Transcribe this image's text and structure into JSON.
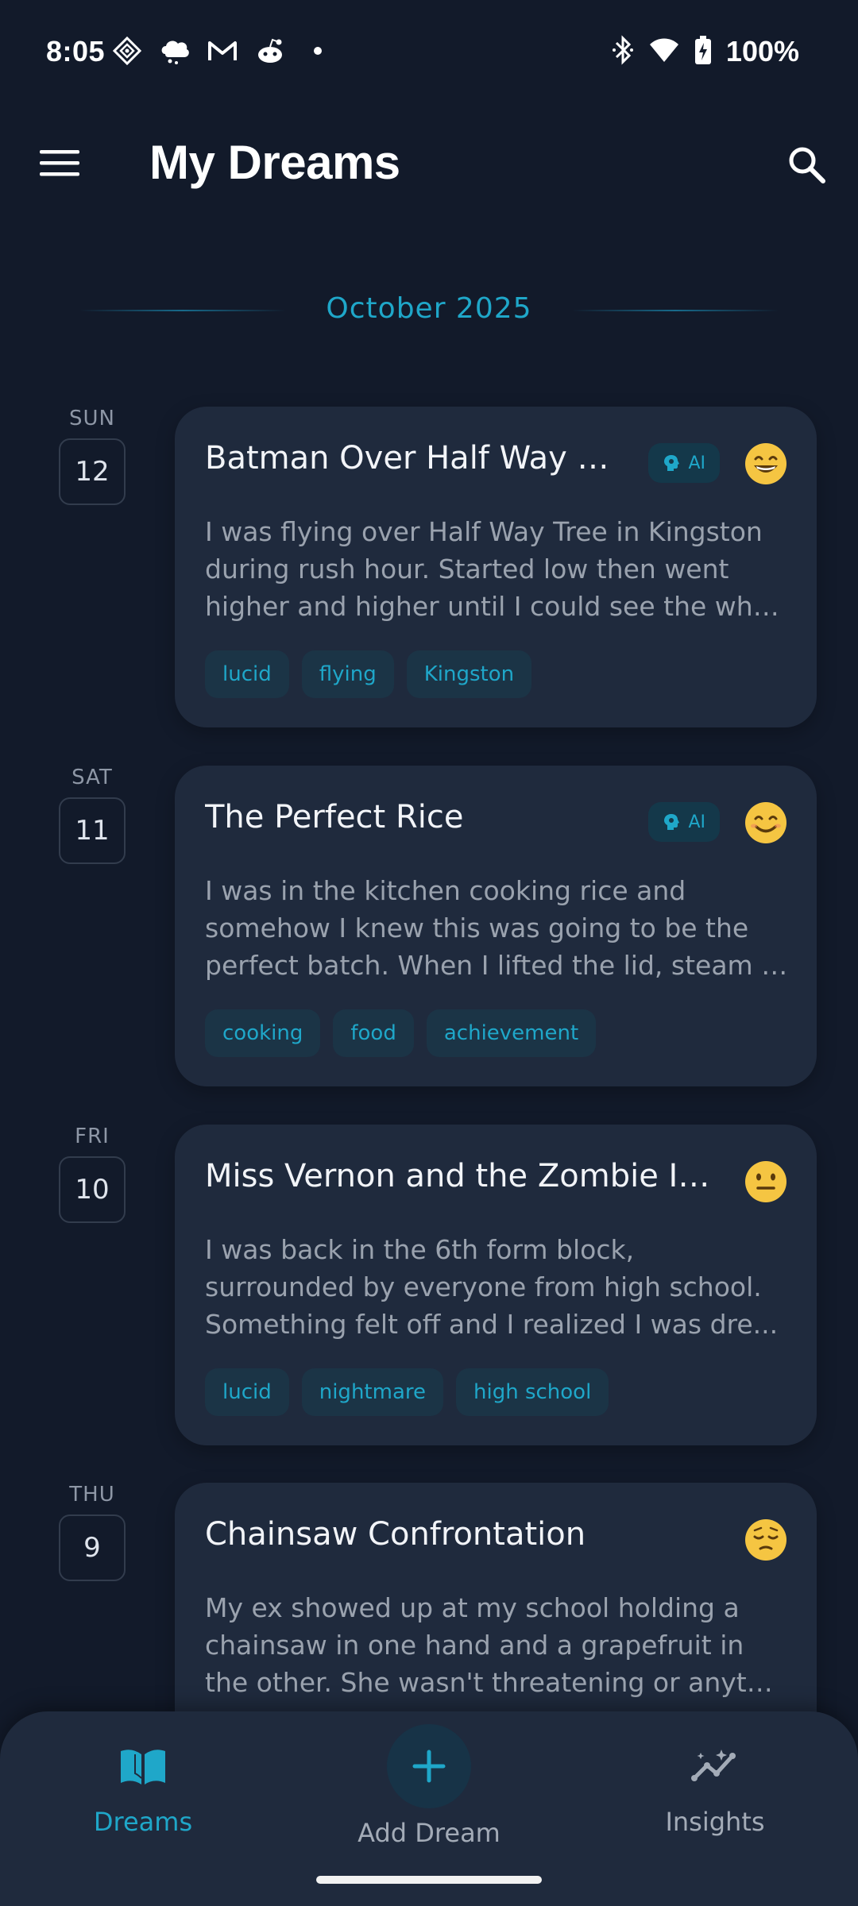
{
  "status_bar": {
    "time": "8:05",
    "icons_left": [
      "game-icon",
      "cloud-icon",
      "mail-icon",
      "reddit-icon",
      "dot-icon"
    ],
    "icons_right": [
      "bluetooth-icon",
      "wifi-icon",
      "battery-charging-icon"
    ],
    "battery": "100%"
  },
  "app_bar": {
    "title": "My Dreams"
  },
  "month": "October 2025",
  "entries": [
    {
      "day_name": "SUN",
      "day_num": "12",
      "title": "Batman Over Half Way Tree",
      "ai": true,
      "ai_label": "AI",
      "mood": "grinning",
      "body": [
        "I was flying over Half Way Tree in Kingston",
        "during rush hour. Started low then went",
        "higher and higher until I could see the who..."
      ],
      "tags": [
        "lucid",
        "flying",
        "Kingston"
      ]
    },
    {
      "day_name": "SAT",
      "day_num": "11",
      "title": "The Perfect Rice",
      "ai": true,
      "ai_label": "AI",
      "mood": "smiling",
      "body": [
        "I was in the kitchen cooking rice and",
        "somehow I knew this was going to be the",
        "perfect batch. When I lifted the lid, steam r..."
      ],
      "tags": [
        "cooking",
        "food",
        "achievement"
      ]
    },
    {
      "day_name": "FRI",
      "day_num": "10",
      "title": "Miss Vernon and the Zombie Inva...",
      "ai": false,
      "mood": "neutral",
      "body": [
        "I was back in the 6th form block,",
        "surrounded by everyone from high school.",
        "Something felt off and I realized I was dre..."
      ],
      "tags": [
        "lucid",
        "nightmare",
        "high school"
      ]
    },
    {
      "day_name": "THU",
      "day_num": "9",
      "title": "Chainsaw Confrontation",
      "ai": false,
      "mood": "pensive",
      "body": [
        "My ex showed up at my school holding a",
        "chainsaw in one hand and a grapefruit in",
        "the other. She wasn't threatening or anythi..."
      ],
      "tags": []
    }
  ],
  "bottom_nav": {
    "dreams": "Dreams",
    "add": "Add Dream",
    "insights": "Insights"
  },
  "colors": {
    "background": "#121a2a",
    "card": "#1f2a3d",
    "accent": "#1fa7c9",
    "mood_yellow": "#f5c542"
  }
}
